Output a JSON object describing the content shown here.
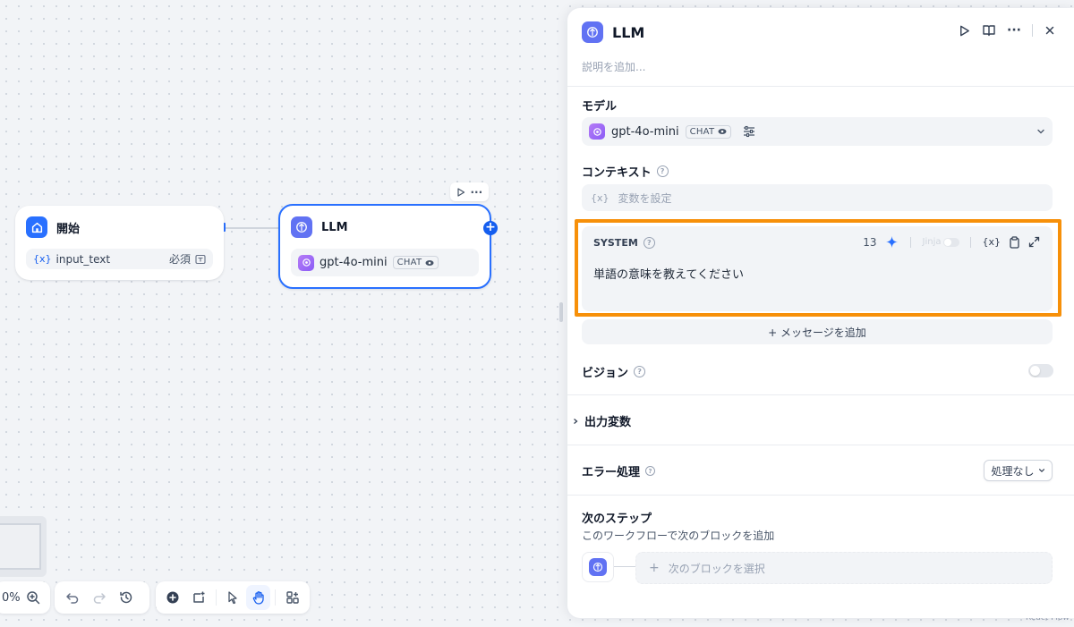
{
  "canvas": {
    "start_node": {
      "title": "開始",
      "var_prefix": "{x}",
      "var_name": "input_text",
      "required_label": "必須"
    },
    "llm_node": {
      "title": "LLM",
      "model": "gpt-4o-mini",
      "model_tag": "CHAT"
    },
    "zoom": "0%",
    "watermark": "React Flow"
  },
  "panel": {
    "title": "LLM",
    "description_placeholder": "説明を追加...",
    "model_section": {
      "label": "モデル",
      "model": "gpt-4o-mini",
      "tag": "CHAT"
    },
    "context_section": {
      "label": "コンテキスト",
      "var_prefix": "{x}",
      "placeholder": "変数を設定"
    },
    "system_prompt": {
      "label": "SYSTEM",
      "count": "13",
      "jinja_label": "Jinja",
      "var_prefix": "{x}",
      "text": "単語の意味を教えてください",
      "highlight_color": "#f79009"
    },
    "add_message_label": "+ メッセージを追加",
    "vision": {
      "label": "ビジョン",
      "enabled": false
    },
    "output_vars": {
      "label": "出力変数"
    },
    "error_handling": {
      "label": "エラー処理",
      "value": "処理なし"
    },
    "next_step": {
      "label": "次のステップ",
      "description": "このワークフローで次のブロックを追加",
      "select_label": "次のブロックを選択",
      "plus": "+"
    }
  },
  "colors": {
    "accent": "#155eef",
    "node_icon_llm": "#6172f3",
    "node_icon_start": "#2970ff"
  }
}
